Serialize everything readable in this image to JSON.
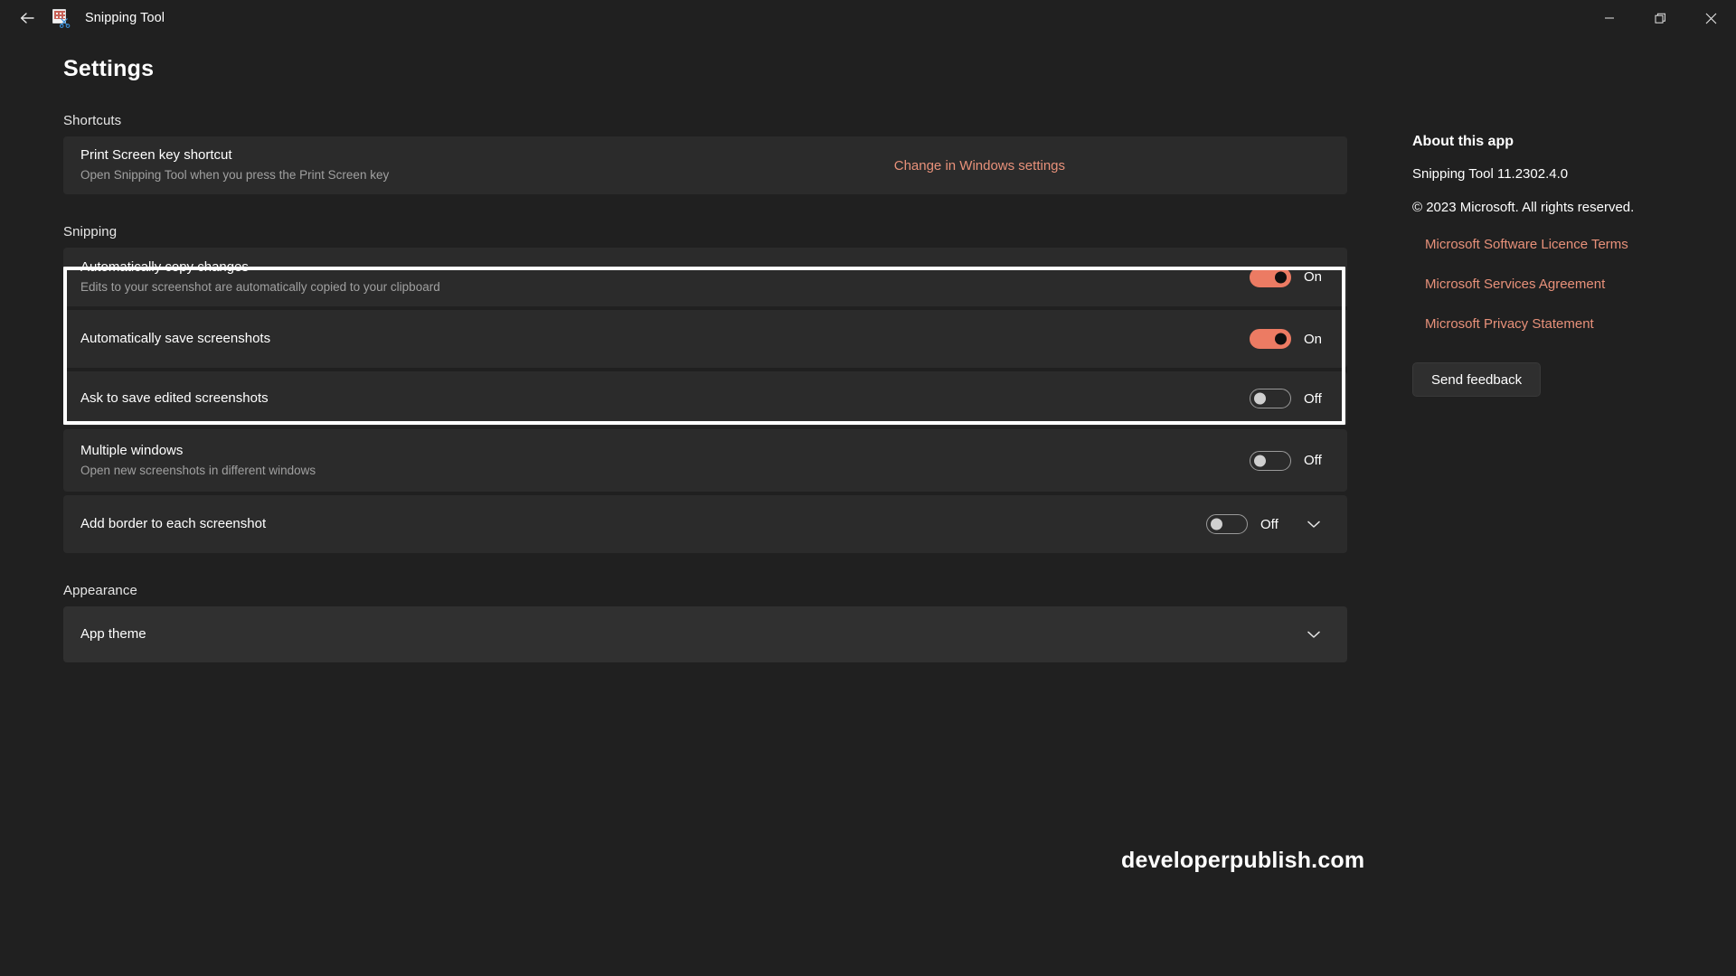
{
  "titlebar": {
    "back_icon": "arrow-left-icon",
    "app_icon": "snipping-tool-icon",
    "app_title": "Snipping Tool",
    "minimize_label": "Minimize",
    "restore_label": "Restore",
    "close_label": "Close"
  },
  "page": {
    "title": "Settings",
    "watermark": "developerpublish.com"
  },
  "sections": {
    "shortcuts": {
      "label": "Shortcuts",
      "row": {
        "title": "Print Screen key shortcut",
        "subtitle": "Open Snipping Tool when you press the Print Screen key",
        "action_link": "Change in Windows settings"
      }
    },
    "snipping": {
      "label": "Snipping",
      "rows": [
        {
          "title": "Automatically copy changes",
          "subtitle": "Edits to your screenshot are automatically copied to your clipboard",
          "toggle_state": "On",
          "toggle_on": true,
          "highlighted": true
        },
        {
          "title": "Automatically save screenshots",
          "subtitle": "",
          "toggle_state": "On",
          "toggle_on": true,
          "highlighted": true
        },
        {
          "title": "Ask to save edited screenshots",
          "subtitle": "",
          "toggle_state": "Off",
          "toggle_on": false,
          "highlighted": false
        },
        {
          "title": "Multiple windows",
          "subtitle": "Open new screenshots in different windows",
          "toggle_state": "Off",
          "toggle_on": false,
          "highlighted": false
        },
        {
          "title": "Add border to each screenshot",
          "subtitle": "",
          "toggle_state": "Off",
          "toggle_on": false,
          "expand_icon": "chevron-down-icon",
          "highlighted": false
        }
      ]
    },
    "appearance": {
      "label": "Appearance",
      "row": {
        "title": "App theme",
        "expand_icon": "chevron-down-icon"
      }
    }
  },
  "about": {
    "heading": "About this app",
    "version": "Snipping Tool 11.2302.4.0",
    "copyright": "© 2023 Microsoft. All rights reserved.",
    "links": [
      "Microsoft Software Licence Terms",
      "Microsoft Services Agreement",
      "Microsoft Privacy Statement"
    ],
    "feedback_button": "Send feedback"
  },
  "colors": {
    "page_bg": "#202020",
    "card_bg": "#2b2b2b",
    "card_bg_alt": "#303030",
    "accent_link": "#e8917a",
    "toggle_on": "#ec7b63",
    "highlight_border": "#ffffff",
    "subtitle_text": "#a0a0a0"
  }
}
